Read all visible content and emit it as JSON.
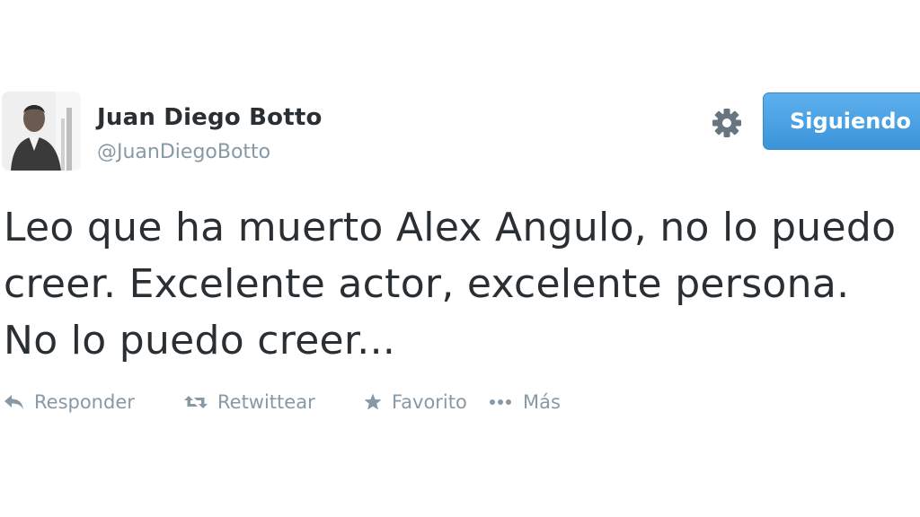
{
  "tweet": {
    "author": {
      "name": "Juan Diego Botto",
      "handle": "@JuanDiegoBotto",
      "avatar": "profile-photo"
    },
    "follow_button_label": "Siguiendo",
    "settings_icon": "gear-icon",
    "text": "Leo que ha muerto Alex Angulo, no lo puedo creer. Excelente actor, excelente persona. No lo puedo creer...",
    "actions": [
      {
        "label": "Responder",
        "icon": "reply-icon"
      },
      {
        "label": "Retwittear",
        "icon": "retweet-icon"
      },
      {
        "label": "Favorito",
        "icon": "star-icon"
      },
      {
        "label": "Más",
        "icon": "more-dots-icon"
      }
    ]
  },
  "colors": {
    "text": "#292f33",
    "muted": "#8899a6",
    "follow_button": "#3b94d9"
  }
}
